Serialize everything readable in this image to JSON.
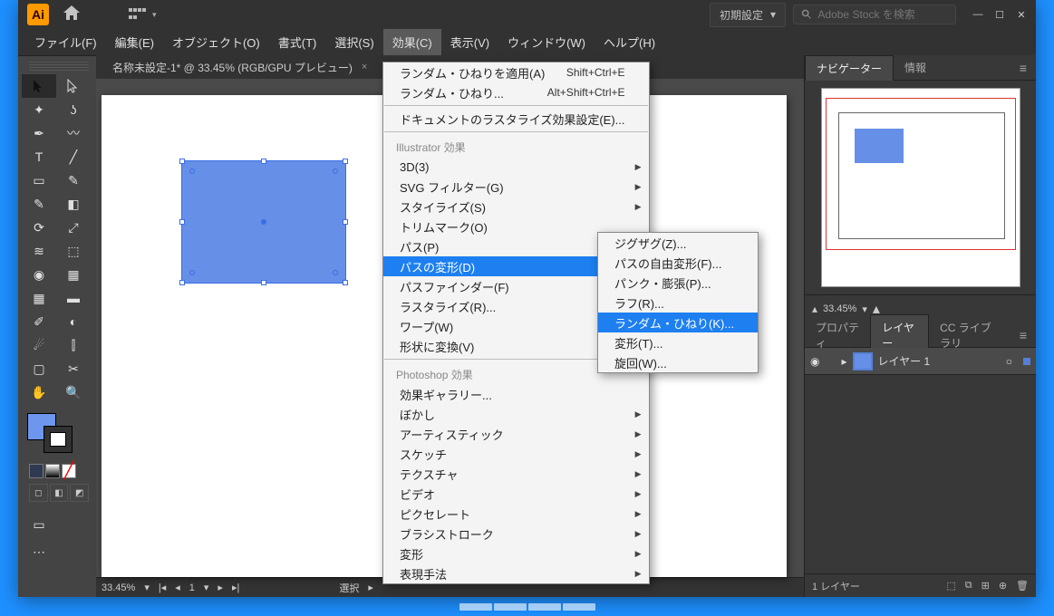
{
  "titleBar": {
    "logo": "Ai",
    "workspace": "初期設定",
    "searchPlaceholder": "Adobe Stock を検索"
  },
  "menus": [
    "ファイル(F)",
    "編集(E)",
    "オブジェクト(O)",
    "書式(T)",
    "選択(S)",
    "効果(C)",
    "表示(V)",
    "ウィンドウ(W)",
    "ヘルプ(H)"
  ],
  "docTab": {
    "title": "名称未設定-1* @ 33.45% (RGB/GPU プレビュー)"
  },
  "effectMenu": {
    "lastEffect": "ランダム・ひねりを適用(A)",
    "lastEffectShortcut": "Shift+Ctrl+E",
    "lastEffect2": "ランダム・ひねり...",
    "lastEffect2Shortcut": "Alt+Shift+Ctrl+E",
    "docRaster": "ドキュメントのラスタライズ効果設定(E)...",
    "illHeader": "Illustrator 効果",
    "illItems": [
      "3D(3)",
      "SVG フィルター(G)",
      "スタイライズ(S)",
      "トリムマーク(O)",
      "パス(P)",
      "パスの変形(D)",
      "パスファインダー(F)",
      "ラスタライズ(R)...",
      "ワープ(W)",
      "形状に変換(V)"
    ],
    "psHeader": "Photoshop 効果",
    "psItems": [
      "効果ギャラリー...",
      "ぼかし",
      "アーティスティック",
      "スケッチ",
      "テクスチャ",
      "ビデオ",
      "ピクセレート",
      "ブラシストローク",
      "変形",
      "表現手法"
    ]
  },
  "distortSubmenu": [
    "ジグザグ(Z)...",
    "パスの自由変形(F)...",
    "パンク・膨張(P)...",
    "ラフ(R)...",
    "ランダム・ひねり(K)...",
    "変形(T)...",
    "旋回(W)..."
  ],
  "status": {
    "zoom": "33.45%",
    "page": "1",
    "tool": "選択"
  },
  "panels": {
    "navTabs": [
      "ナビゲーター",
      "情報"
    ],
    "navZoom": "33.45%",
    "layerTabs": [
      "プロパティ",
      "レイヤー",
      "CC ライブラリ"
    ],
    "layerName": "レイヤー 1",
    "layerCount": "1 レイヤー"
  }
}
